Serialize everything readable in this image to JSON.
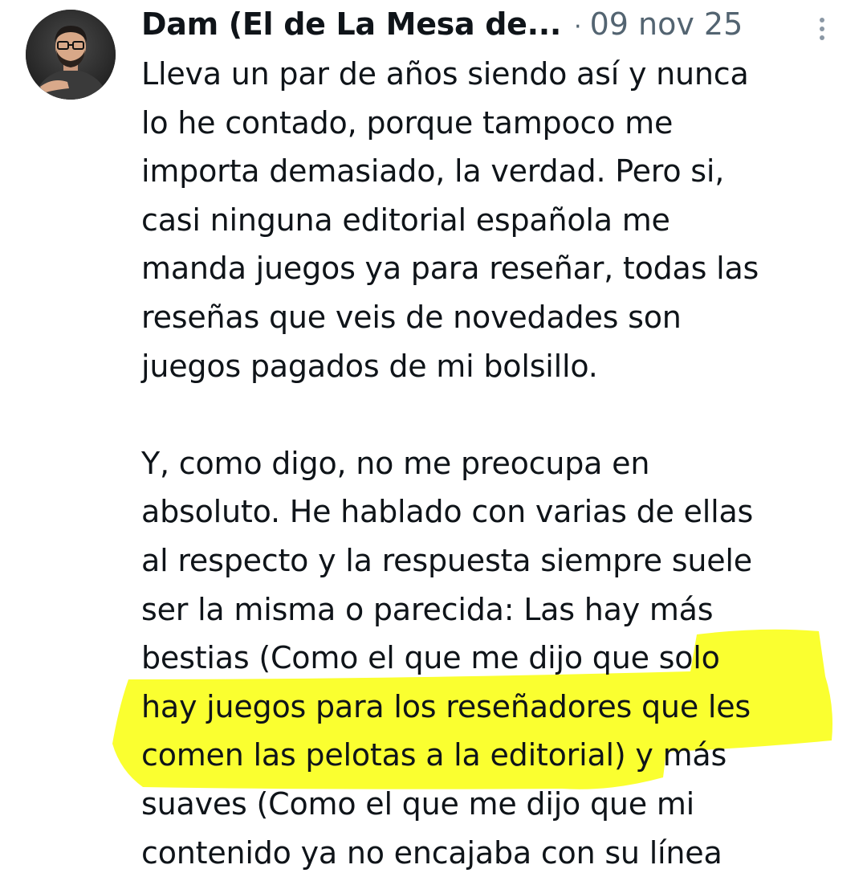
{
  "post": {
    "author_name": "Dam (El de La Mesa de...",
    "separator": "·",
    "date": "09 nov 25",
    "paragraph1": [
      "Lleva un par de años siendo así y nunca",
      "lo he contado, porque tampoco me",
      "importa demasiado, la verdad. Pero si,",
      "casi ninguna editorial española me",
      "manda juegos ya para reseñar, todas las",
      "reseñas que veis de novedades son",
      "juegos pagados de mi bolsillo."
    ],
    "paragraph2": [
      "Y, como digo, no me preocupa en",
      "absoluto. He hablado con varias de ellas",
      "al respecto y la respuesta siempre suele",
      "ser la misma o parecida: Las hay más",
      "bestias (Como el que me dijo que solo",
      "hay juegos para los reseñadores que les",
      "comen las pelotas a la editorial) y más",
      "suaves (Como el que me dijo que mi",
      "contenido ya no encajaba con su línea"
    ]
  },
  "colors": {
    "highlight": "#faff1e",
    "text": "#0f1419",
    "muted": "#536471"
  },
  "icons": {
    "more": "more-options-icon",
    "avatar": "user-avatar-photo"
  }
}
